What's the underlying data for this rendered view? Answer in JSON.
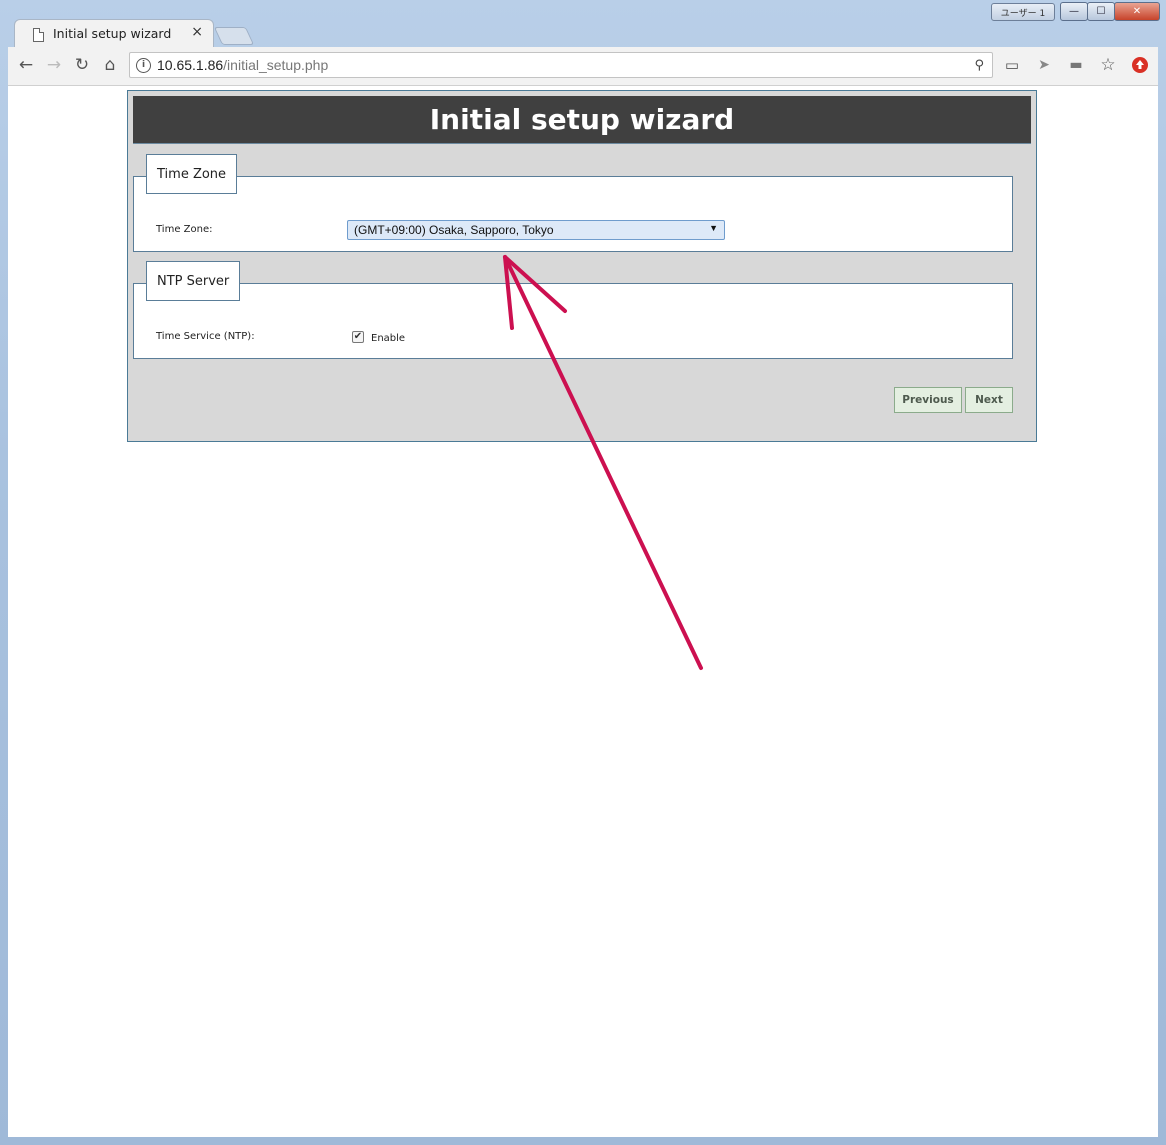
{
  "window": {
    "user_badge": "ユーザー 1",
    "controls": {
      "minimize": "—",
      "maximize": "☐",
      "close": "✕"
    }
  },
  "tab": {
    "title": "Initial setup wizard",
    "close": "×"
  },
  "toolbar": {
    "url_host": "10.65.1.86",
    "url_path": "/initial_setup.php"
  },
  "wizard": {
    "title": "Initial setup wizard",
    "time_zone_section": {
      "legend": "Time Zone",
      "label": "Time Zone:",
      "selected_value": "(GMT+09:00) Osaka, Sapporo, Tokyo"
    },
    "ntp_section": {
      "legend": "NTP Server",
      "label": "Time Service (NTP):",
      "checkbox_label": "Enable",
      "checked": true
    },
    "buttons": {
      "previous": "Previous",
      "next": "Next"
    }
  },
  "annotation": {
    "arrow_color": "#cc1050"
  }
}
